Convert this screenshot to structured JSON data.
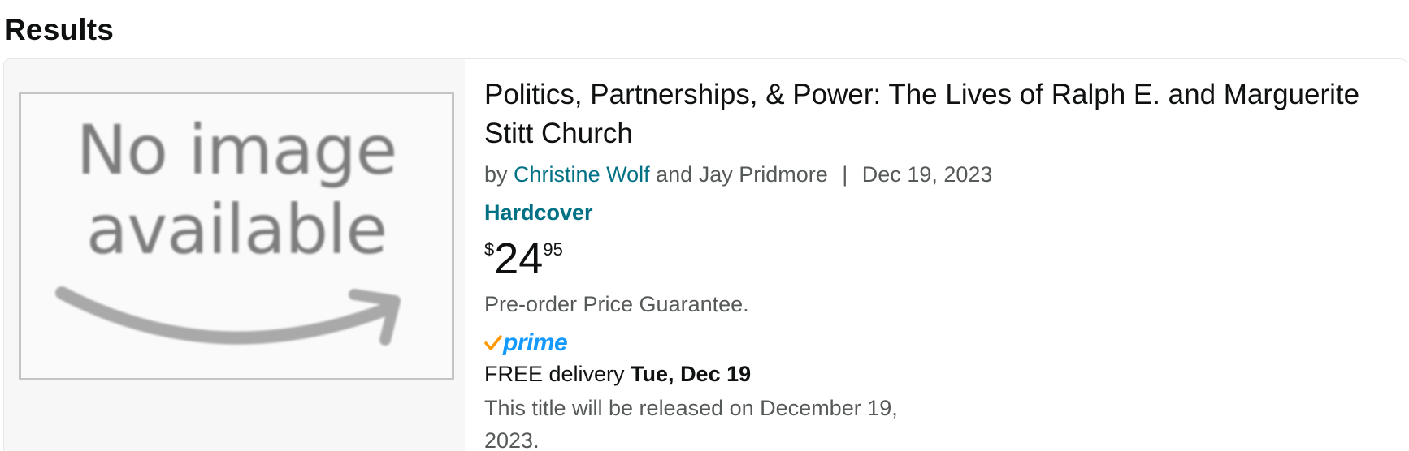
{
  "page": {
    "heading": "Results"
  },
  "result": {
    "image": {
      "line1": "No image",
      "line2": "available",
      "icon": "no-image-placeholder"
    },
    "title": "Politics, Partnerships, & Power: The Lives of Ralph E. and Marguerite Stitt Church",
    "byline": {
      "prefix": "by",
      "author1": "Christine Wolf",
      "conjunction": "and",
      "author2": "Jay Pridmore",
      "separator": "|",
      "date": "Dec 19, 2023"
    },
    "format": "Hardcover",
    "price": {
      "symbol": "$",
      "whole": "24",
      "fraction": "95"
    },
    "price_note": "Pre-order Price Guarantee.",
    "prime": {
      "label": "prime",
      "icon": "prime-check-icon",
      "check_color": "#ff9900",
      "text_color": "#1399ff"
    },
    "delivery": {
      "label": "FREE delivery",
      "date": "Tue, Dec 19"
    },
    "release_note": "This title will be released on December 19, 2023."
  },
  "colors": {
    "link": "#007185",
    "text": "#0f1111",
    "secondary_text": "#565959",
    "image_pane_bg": "#f7f7f7"
  }
}
